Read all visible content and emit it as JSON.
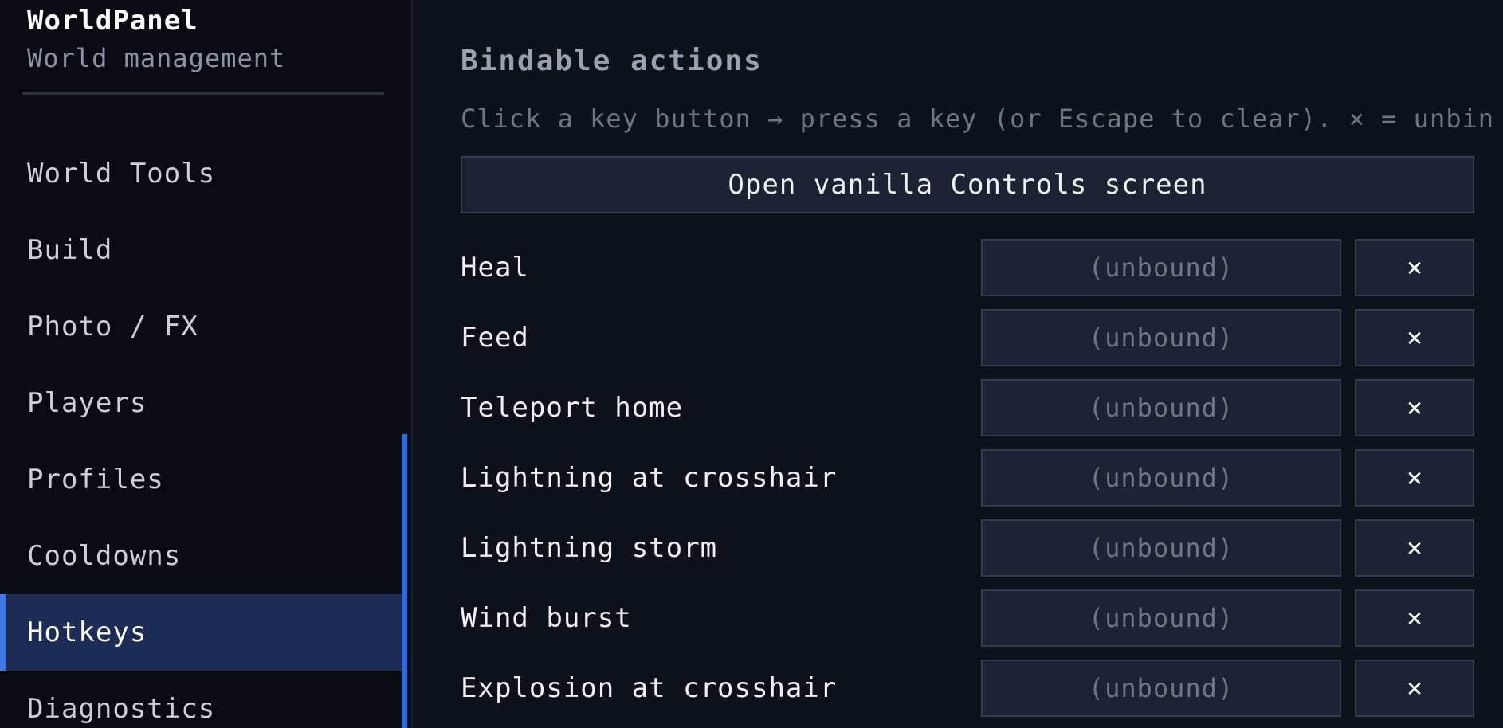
{
  "sidebar": {
    "title": "WorldPanel",
    "subtitle": "World management",
    "items": [
      {
        "label": "World Tools",
        "active": false
      },
      {
        "label": "Build",
        "active": false
      },
      {
        "label": "Photo / FX",
        "active": false
      },
      {
        "label": "Players",
        "active": false
      },
      {
        "label": "Profiles",
        "active": false
      },
      {
        "label": "Cooldowns",
        "active": false
      },
      {
        "label": "Hotkeys",
        "active": true
      },
      {
        "label": "Diagnostics",
        "active": false
      }
    ]
  },
  "main": {
    "section_title": "Bindable actions",
    "hint": "Click a key button → press a key (or Escape to clear). × = unbin",
    "open_controls_label": "Open vanilla Controls screen",
    "bindings": [
      {
        "action": "Heal",
        "key": "(unbound)",
        "clear": "×"
      },
      {
        "action": "Feed",
        "key": "(unbound)",
        "clear": "×"
      },
      {
        "action": "Teleport home",
        "key": "(unbound)",
        "clear": "×"
      },
      {
        "action": "Lightning at crosshair",
        "key": "(unbound)",
        "clear": "×"
      },
      {
        "action": "Lightning storm",
        "key": "(unbound)",
        "clear": "×"
      },
      {
        "action": "Wind burst",
        "key": "(unbound)",
        "clear": "×"
      },
      {
        "action": "Explosion at crosshair",
        "key": "(unbound)",
        "clear": "×"
      }
    ]
  },
  "colors": {
    "accent": "#3d78e6",
    "active_bg": "#1c2c55",
    "sidebar_bg": "#080b12",
    "main_bg": "#0d111a",
    "button_bg": "#1c2231"
  }
}
